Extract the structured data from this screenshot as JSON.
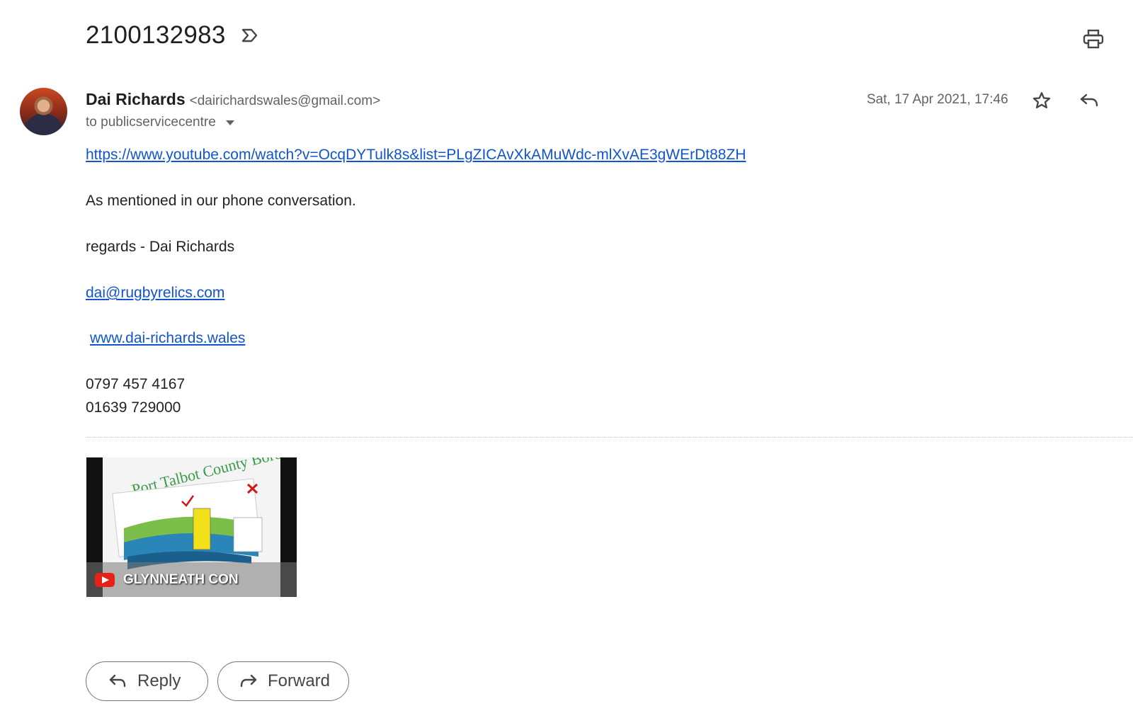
{
  "message": {
    "subject": "2100132983",
    "sender": {
      "name": "Dai Richards",
      "email": "<dairichardswales@gmail.com>"
    },
    "recipients": "to publicservicecentre",
    "date": "Sat, 17 Apr 2021, 17:46",
    "body": {
      "link_youtube": "https://www.youtube.com/watch?v=OcqDYTulk8s&list=PLgZICAvXkAMuWdc-mlXvAE3gWErDt88ZH",
      "line_mentioned": "As mentioned in our phone conversation.",
      "line_regards": "regards - Dai Richards",
      "link_email": "dai@rugbyrelics.com",
      "link_website": "www.dai-richards.wales",
      "phone_1": "0797 457 4167",
      "phone_2": "01639 729000"
    },
    "attachment": {
      "video_title": "GLYNNEATH CON",
      "thumbnail_caption": "Port Talbot County Borough"
    }
  },
  "actions": {
    "reply_label": "Reply",
    "forward_label": "Forward"
  },
  "icons": {
    "label": "label-outline-icon",
    "print": "printer-icon",
    "star": "star-outline-icon",
    "reply": "reply-arrow-icon",
    "forward": "forward-arrow-icon",
    "dropdown": "caret-down-icon"
  },
  "colors": {
    "link": "#1155cc",
    "youtube_red": "#e62117"
  }
}
